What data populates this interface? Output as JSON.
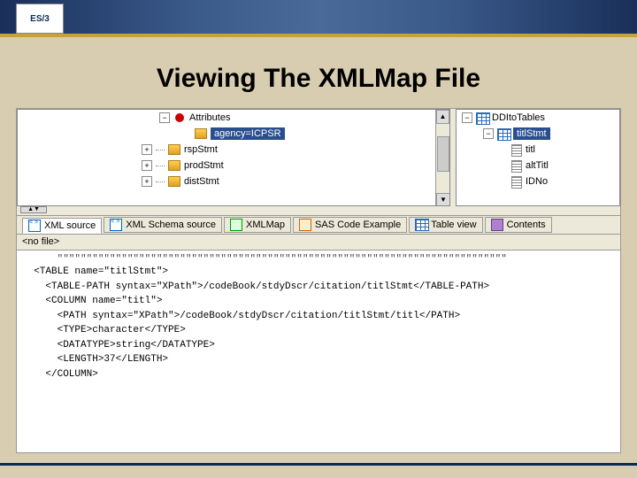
{
  "logo": "ES/3",
  "title": "Viewing The XMLMap File",
  "left_tree": {
    "attributes_label": "Attributes",
    "selected_attr": "agency=ICPSR",
    "items": [
      {
        "label": "rspStmt"
      },
      {
        "label": "prodStmt"
      },
      {
        "label": "distStmt"
      }
    ]
  },
  "right_tree": {
    "root": "DDItoTables",
    "selected": "titlStmt",
    "columns": [
      {
        "label": "titl"
      },
      {
        "label": "altTitl"
      },
      {
        "label": "IDNo"
      }
    ]
  },
  "tabs": [
    {
      "label": "XML source",
      "icon": "xml"
    },
    {
      "label": "XML Schema source",
      "icon": "xml"
    },
    {
      "label": "XMLMap",
      "icon": "map"
    },
    {
      "label": "SAS Code Example",
      "icon": "sas"
    },
    {
      "label": "Table view",
      "icon": "table"
    },
    {
      "label": "Contents",
      "icon": "book"
    }
  ],
  "status_text": "<no file>",
  "code_lines": [
    "  <TABLE name=\"titlStmt\">",
    "    <TABLE-PATH syntax=\"XPath\">/codeBook/stdyDscr/citation/titlStmt</TABLE-PATH>",
    "",
    "    <COLUMN name=\"titl\">",
    "      <PATH syntax=\"XPath\">/codeBook/stdyDscr/citation/titlStmt/titl</PATH>",
    "      <TYPE>character</TYPE>",
    "      <DATATYPE>string</DATATYPE>",
    "      <LENGTH>37</LENGTH>",
    "    </COLUMN>"
  ]
}
